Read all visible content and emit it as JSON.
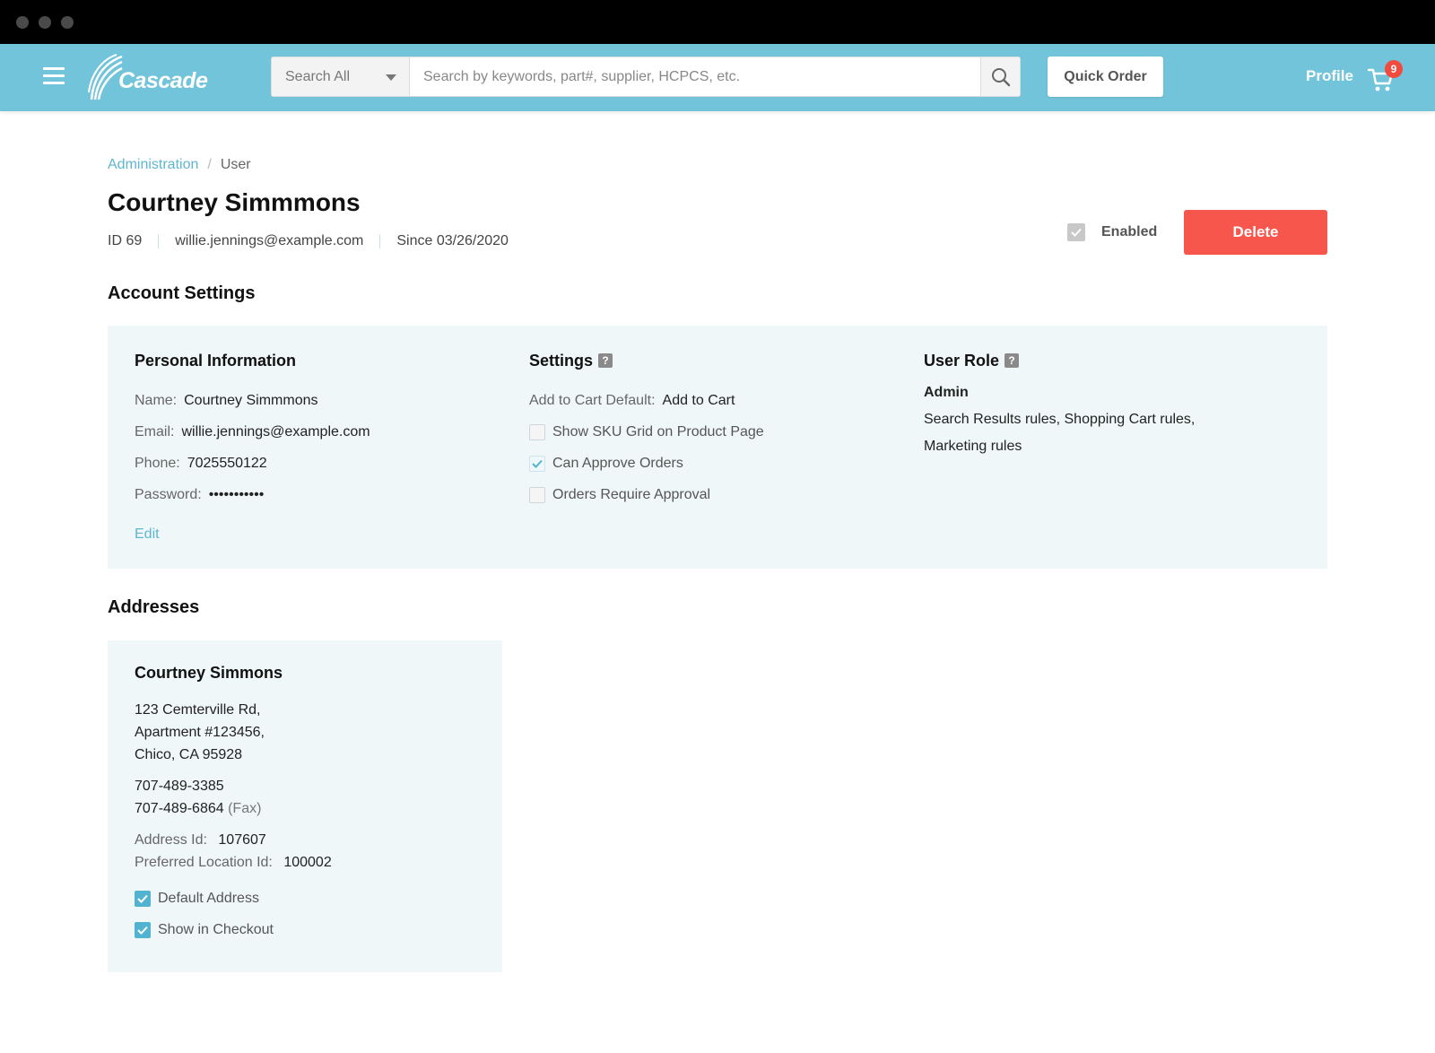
{
  "header": {
    "logo_text": "Cascade",
    "search_category": "Search All",
    "search_placeholder": "Search by keywords, part#, supplier, HCPCS, etc.",
    "quick_order_label": "Quick Order",
    "profile_label": "Profile",
    "cart_count": "9",
    "brand_color": "#72c4da"
  },
  "breadcrumb": {
    "parent": "Administration",
    "separator": "/",
    "current": "User"
  },
  "user": {
    "title": "Courtney Simmmons",
    "id_text": "ID 69",
    "email": "willie.jennings@example.com",
    "since_text": "Since 03/26/2020",
    "enabled_label": "Enabled",
    "enabled": true,
    "delete_label": "Delete",
    "delete_color": "#f6564b"
  },
  "account_settings": {
    "section_title": "Account Settings",
    "personal": {
      "title": "Personal Information",
      "name_label": "Name:",
      "name_value": "Courtney Simmmons",
      "email_label": "Email:",
      "email_value": "willie.jennings@example.com",
      "phone_label": "Phone:",
      "phone_value": "7025550122",
      "password_label": "Password:",
      "password_value": "•••••••••••",
      "edit_label": "Edit"
    },
    "settings": {
      "title": "Settings",
      "help_glyph": "?",
      "add_to_cart_label": "Add to Cart Default:",
      "add_to_cart_value": "Add to Cart",
      "options": [
        {
          "label": "Show SKU Grid on Product Page",
          "checked": false
        },
        {
          "label": "Can Approve Orders",
          "checked": true
        },
        {
          "label": "Orders Require Approval",
          "checked": false
        }
      ]
    },
    "user_role": {
      "title": "User Role",
      "help_glyph": "?",
      "role": "Admin",
      "description_line1": "Search Results rules, Shopping Cart rules,",
      "description_line2": "Marketing rules"
    }
  },
  "addresses": {
    "section_title": "Addresses",
    "items": [
      {
        "name": "Courtney Simmons",
        "line1": "123 Cemterville Rd,",
        "line2": "Apartment #123456,",
        "line3": "Chico, CA 95928",
        "phone": "707-489-3385",
        "fax": "707-489-6864",
        "fax_suffix": "(Fax)",
        "address_id_label": "Address Id:",
        "address_id": "107607",
        "preferred_label": "Preferred Location Id:",
        "preferred_id": "100002",
        "default_label": "Default Address",
        "default_checked": true,
        "checkout_label": "Show in Checkout",
        "checkout_checked": true
      }
    ]
  }
}
